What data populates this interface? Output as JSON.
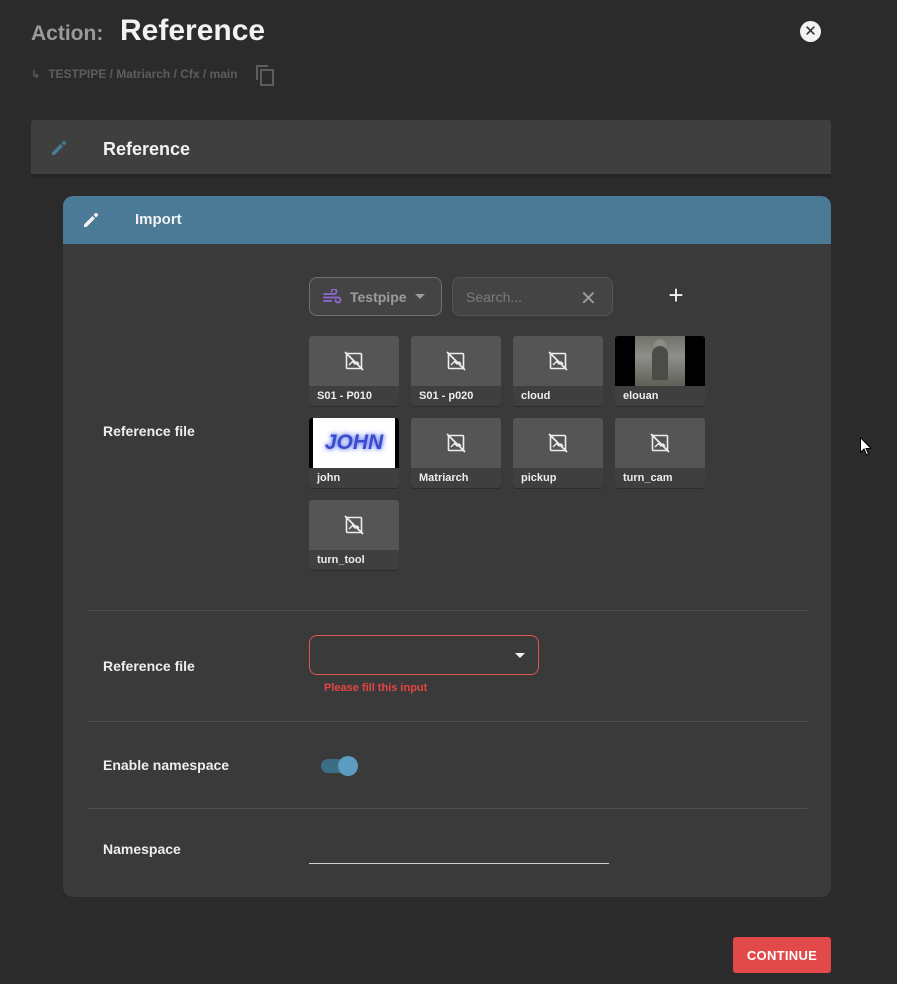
{
  "header": {
    "action_label": "Action:",
    "title": "Reference",
    "breadcrumb_arrow": "↳",
    "breadcrumb": "TESTPIPE / Matriarch / Cfx / main"
  },
  "reference_section": {
    "title": "Reference"
  },
  "import_section": {
    "title": "Import",
    "reference_file_label": "Reference file",
    "project_select": {
      "value": "Testpipe"
    },
    "search": {
      "placeholder": "Search...",
      "clear": "✕"
    },
    "add": "+",
    "files": [
      {
        "name": "S01 - P010",
        "thumbnail": "no-image"
      },
      {
        "name": "S01 - p020",
        "thumbnail": "no-image"
      },
      {
        "name": "cloud",
        "thumbnail": "no-image"
      },
      {
        "name": "elouan",
        "thumbnail": "statue-photo"
      },
      {
        "name": "john",
        "thumbnail": "john-text-image",
        "thumb_text": "JOHN"
      },
      {
        "name": "Matriarch",
        "thumbnail": "no-image"
      },
      {
        "name": "pickup",
        "thumbnail": "no-image"
      },
      {
        "name": "turn_cam",
        "thumbnail": "no-image"
      },
      {
        "name": "turn_tool",
        "thumbnail": "no-image"
      }
    ],
    "reference_file_select": {
      "label": "Reference file",
      "value": "",
      "error": "Please fill this input"
    },
    "enable_namespace": {
      "label": "Enable namespace",
      "checked": true
    },
    "namespace": {
      "label": "Namespace",
      "value": ""
    }
  },
  "actions": {
    "continue": "CONTINUE"
  },
  "colors": {
    "accent": "#4a7a95",
    "error": "#e64444",
    "continue": "#e24a49",
    "background": "#2b2b2b"
  }
}
